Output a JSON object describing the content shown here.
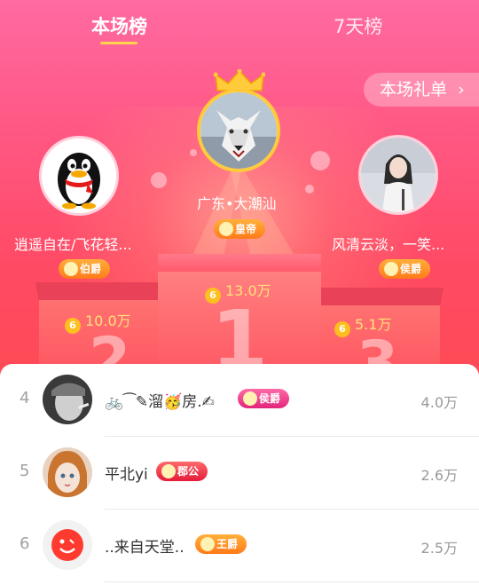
{
  "tabs": {
    "current": "本场榜",
    "week": "7天榜"
  },
  "gift_list_button": "本场礼单",
  "podium": {
    "first": {
      "rank": "1",
      "name": "广东•大潮汕",
      "badge": "皇帝",
      "score": "13.0万"
    },
    "second": {
      "rank": "2",
      "name": "逍遥自在/飞花轻...",
      "badge": "伯爵",
      "score": "10.0万"
    },
    "third": {
      "rank": "3",
      "name": "风清云淡，一笑...",
      "badge": "侯爵",
      "score": "5.1万"
    }
  },
  "list": [
    {
      "rank": "4",
      "name": "🚲⁀✎溜🥳房.✍",
      "badge": "侯爵",
      "score": "4.0万"
    },
    {
      "rank": "5",
      "name": "平北yi",
      "badge": "郡公",
      "score": "2.6万"
    },
    {
      "rank": "6",
      "name": "..来自天堂..",
      "badge": "王爵",
      "score": "2.5万"
    }
  ],
  "coin_glyph": "6",
  "colors": {
    "accent_gold": "#ffcb3a",
    "score_yellow": "#ffe27a",
    "bg_pink": "#ff5783"
  }
}
